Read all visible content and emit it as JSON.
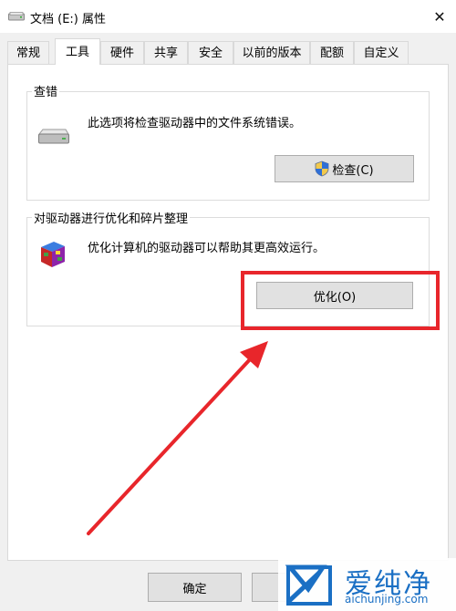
{
  "window": {
    "title": "文档 (E:) 属性",
    "close_glyph": "✕"
  },
  "tabs": [
    {
      "label": "常规"
    },
    {
      "label": "工具",
      "active": true
    },
    {
      "label": "硬件"
    },
    {
      "label": "共享"
    },
    {
      "label": "安全"
    },
    {
      "label": "以前的版本"
    },
    {
      "label": "配额"
    },
    {
      "label": "自定义"
    }
  ],
  "error_check": {
    "title": "查错",
    "description": "此选项将检查驱动器中的文件系统错误。",
    "button_label": "检查(C)",
    "icon": "drive-icon"
  },
  "optimize": {
    "title": "对驱动器进行优化和碎片整理",
    "description": "优化计算机的驱动器可以帮助其更高效运行。",
    "button_label": "优化(O)",
    "icon": "defrag-icon"
  },
  "footer": {
    "ok_label": "确定"
  },
  "watermark": {
    "text": "爱纯净",
    "url": "aichunjing.com"
  },
  "colors": {
    "highlight": "#e8262b",
    "accent": "#1a6fc4"
  }
}
